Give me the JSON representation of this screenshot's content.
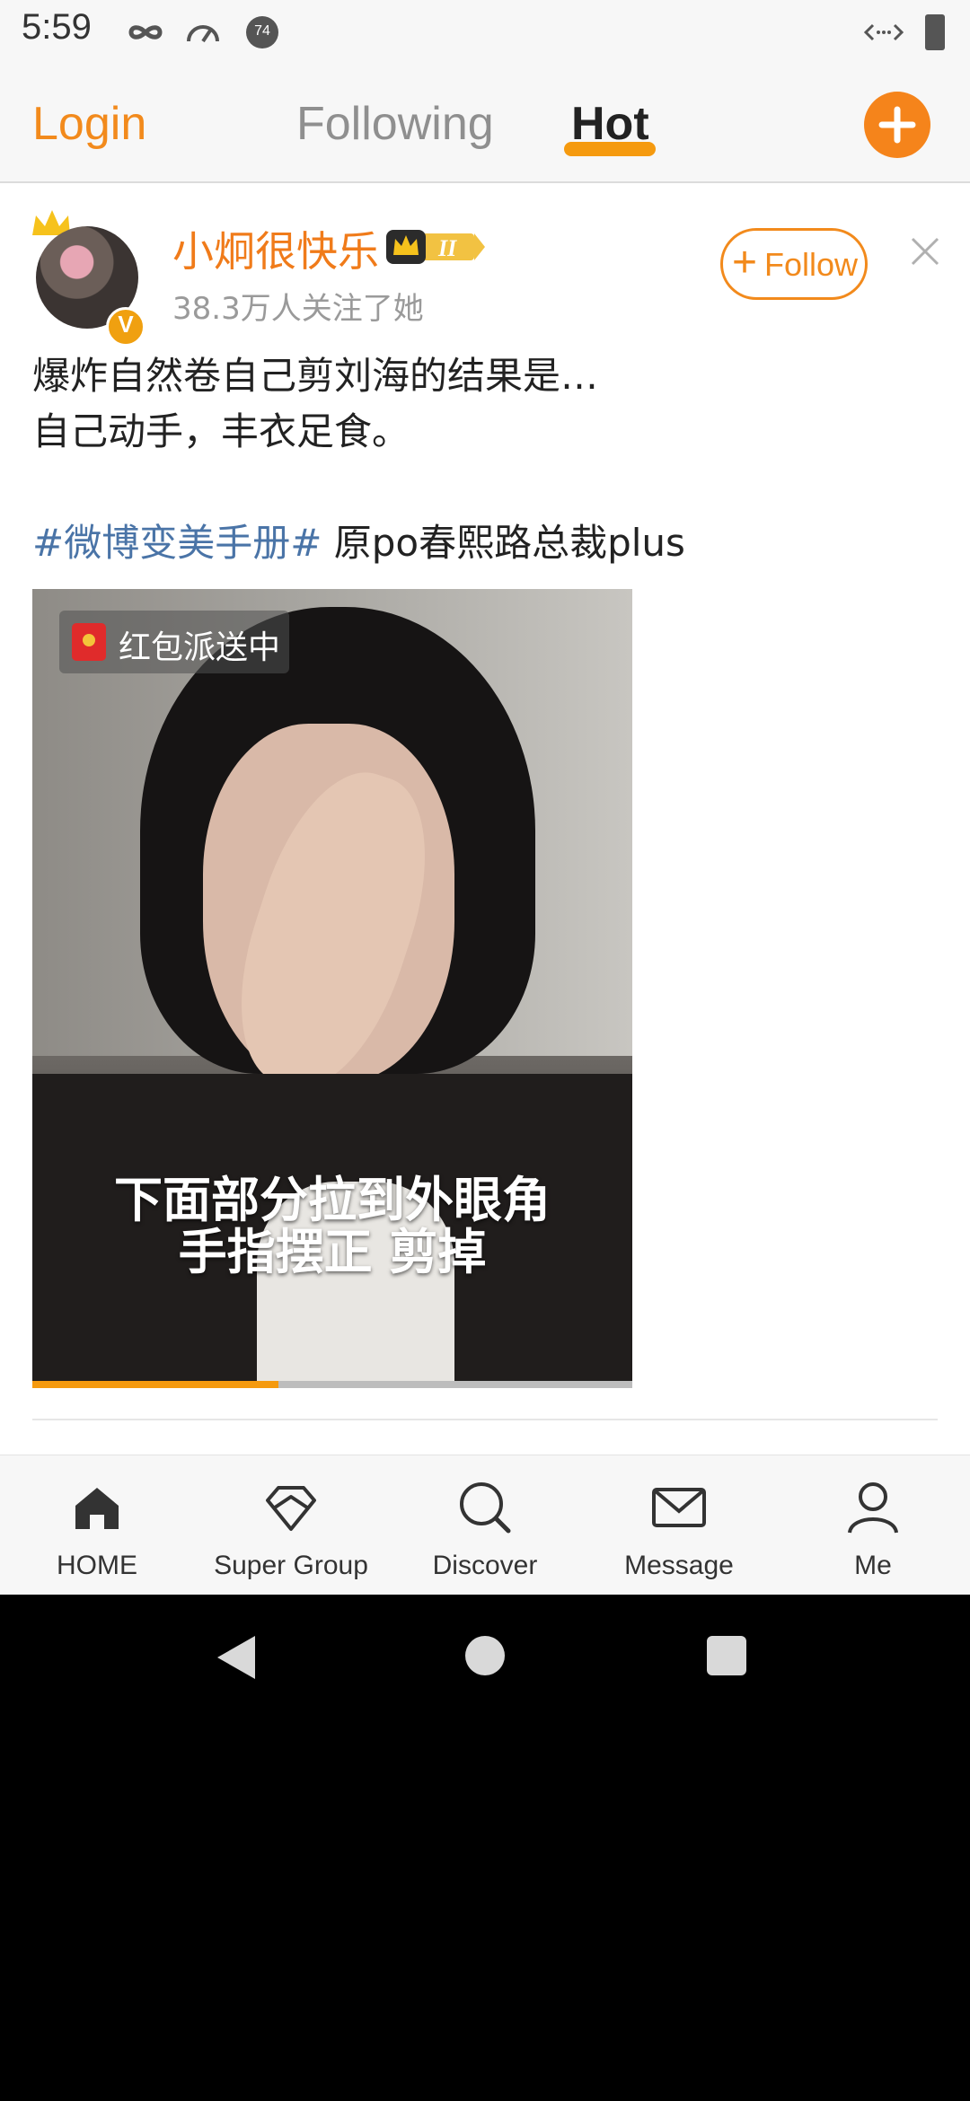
{
  "status_bar": {
    "time": "5:59",
    "notification_count": "74"
  },
  "top_tabs": {
    "login": "Login",
    "following": "Following",
    "hot": "Hot",
    "active": "Hot"
  },
  "post": {
    "username": "小炯很快乐",
    "member_level": "II",
    "followers": "38.3万人关注了她",
    "verified_mark": "V",
    "follow_button": {
      "plus": "+",
      "label": "Follow"
    },
    "text": {
      "line1": "爆炸自然卷自己剪刘海的结果是…",
      "line2": "自己动手，丰衣足食。",
      "hashtag": "#微博变美手册#",
      "tail": " 原po春熙路总裁plus"
    },
    "video": {
      "red_packet_label": "红包派送中",
      "subtitle_line1": "下面部分拉到外眼角",
      "subtitle_line2": "手指摆正 剪掉",
      "progress_fraction": 0.41
    }
  },
  "bottom_nav": {
    "home": "HOME",
    "super_group": "Super Group",
    "discover": "Discover",
    "message": "Message",
    "me": "Me",
    "active": "HOME"
  },
  "colors": {
    "accent_orange": "#f28a1c",
    "hashtag_blue": "#4a74a7",
    "username_orange": "#f07b1a"
  },
  "icons": [
    "infinity-icon",
    "speedometer-icon",
    "notification-badge-icon",
    "signal-icon",
    "battery-icon",
    "add-icon",
    "crown-icon",
    "close-icon",
    "red-packet-icon",
    "home-icon",
    "diamond-icon",
    "search-icon",
    "mail-icon",
    "person-icon",
    "back-icon",
    "home-circle-icon",
    "recents-icon"
  ]
}
